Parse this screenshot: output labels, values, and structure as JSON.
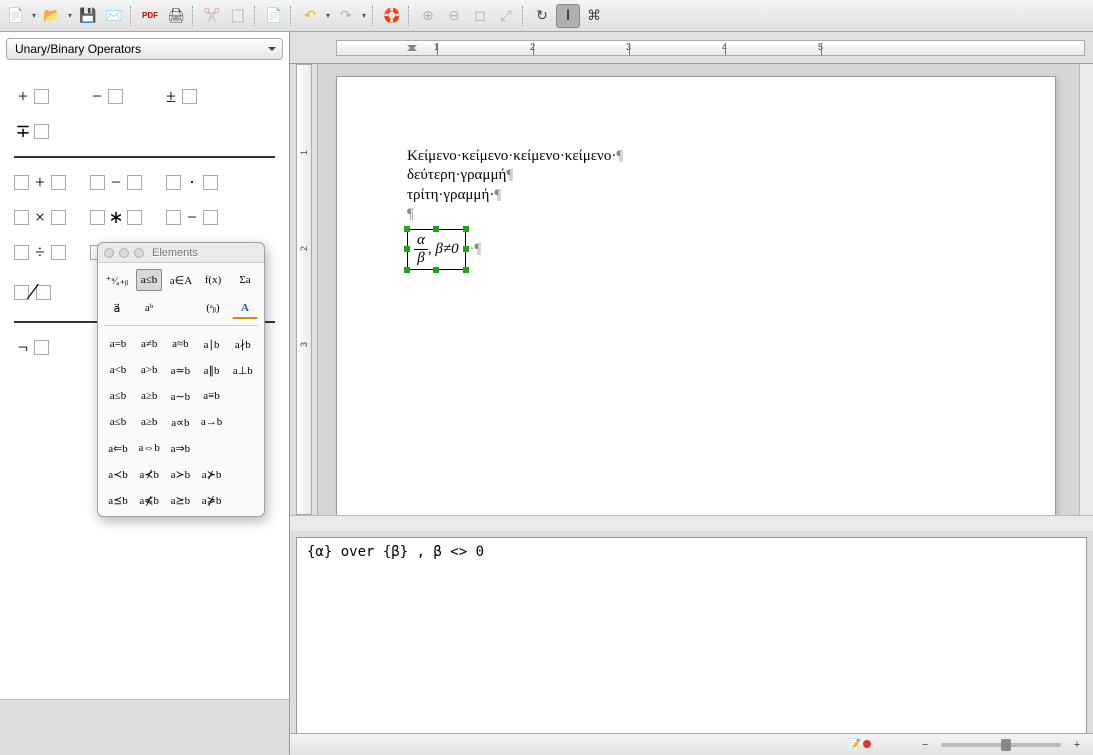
{
  "toolbar": {
    "items": [
      {
        "icon": "📄",
        "name": "new-doc",
        "interact": true,
        "dd": true
      },
      {
        "icon": "📂",
        "name": "open",
        "interact": true,
        "dd": true
      },
      {
        "icon": "💾",
        "name": "save",
        "interact": true
      },
      {
        "icon": "✉️",
        "name": "mail",
        "interact": true
      },
      {
        "sep": true
      },
      {
        "icon": "PDF",
        "name": "export-pdf",
        "interact": true,
        "small": true
      },
      {
        "icon": "🖨",
        "name": "print",
        "interact": true
      },
      {
        "sep": true
      },
      {
        "icon": "✂️",
        "name": "cut",
        "interact": false,
        "dim": true
      },
      {
        "icon": "📋",
        "name": "copy",
        "interact": false,
        "dim": true
      },
      {
        "sep": true
      },
      {
        "icon": "📄",
        "name": "paste",
        "interact": true
      },
      {
        "sep": true
      },
      {
        "icon": "↶",
        "name": "undo",
        "interact": true,
        "color": "#e6b800",
        "dd": true
      },
      {
        "icon": "↷",
        "name": "redo",
        "interact": false,
        "dim": true,
        "dd": true
      },
      {
        "sep": true
      },
      {
        "icon": "🛟",
        "name": "help",
        "interact": true
      },
      {
        "sep": true
      },
      {
        "icon": "⊕",
        "name": "zoom-in",
        "interact": false,
        "dim": true
      },
      {
        "icon": "⊖",
        "name": "zoom-out",
        "interact": false,
        "dim": true
      },
      {
        "icon": "◻",
        "name": "zoom-100",
        "interact": false,
        "dim": true
      },
      {
        "icon": "⤢",
        "name": "zoom-fit",
        "interact": false,
        "dim": true
      },
      {
        "sep": true
      },
      {
        "icon": "↻",
        "name": "refresh",
        "interact": true
      },
      {
        "icon": "𝐈",
        "name": "formula-cursor",
        "interact": true,
        "active": true
      },
      {
        "icon": "⌘",
        "name": "symbols",
        "interact": true
      }
    ]
  },
  "sidebar": {
    "combo": "Unary/Binary Operators",
    "group1": [
      {
        "lbl": "+",
        "name": "plus-sign"
      },
      {
        "lbl": "−",
        "name": "minus-sign"
      },
      {
        "lbl": "±",
        "name": "plus-minus"
      },
      {
        "lbl": "∓",
        "name": "minus-plus"
      }
    ],
    "group2": [
      {
        "lbl": "+",
        "name": "addition"
      },
      {
        "lbl": "−",
        "name": "subtraction"
      },
      {
        "lbl": "·",
        "name": "dot-product"
      },
      {
        "lbl": "×",
        "name": "multiplication"
      },
      {
        "lbl": "∗",
        "name": "asterisk"
      },
      {
        "lbl": "−",
        "name": "subtraction-alt"
      },
      {
        "lbl": "÷",
        "name": "division"
      },
      {
        "lbl": "÷",
        "name": "division-alt"
      },
      {
        "lbl": "−",
        "name": "minus-alt"
      },
      {
        "lbl": "/",
        "name": "fraction",
        "slash": true
      }
    ],
    "group3": [
      {
        "lbl": "¬",
        "name": "boolean-not"
      }
    ]
  },
  "elements_window": {
    "title": "Elements",
    "categories": [
      {
        "lbl": "⁺ᵃ⁄ₐ₊ᵦ",
        "name": "cat-unary"
      },
      {
        "lbl": "a≤b",
        "name": "cat-relations",
        "sel": true
      },
      {
        "lbl": "a∈A",
        "name": "cat-set"
      },
      {
        "lbl": "f(x)",
        "name": "cat-functions"
      },
      {
        "lbl": "Σa",
        "name": "cat-operators"
      },
      {
        "lbl": "a⃗",
        "name": "cat-attributes"
      },
      {
        "lbl": "aᵇ",
        "name": "cat-brackets"
      },
      {
        "lbl": "",
        "name": "cat-spacer",
        "empty": true
      },
      {
        "lbl": "(ᵃᵦ)",
        "name": "cat-formats"
      },
      {
        "lbl": "A͟",
        "name": "cat-others",
        "colorA": true
      }
    ],
    "relations": [
      "a=b",
      "a≠b",
      "a≈b",
      "a∣b",
      "a∤b",
      "a<b",
      "a>b",
      "a≃b",
      "a∥b",
      "a⊥b",
      "a≤b",
      "a≥b",
      "a∼b",
      "a≡b",
      "",
      "a≤b",
      "a≥b",
      "a∝b",
      "a→b",
      "",
      "a⇐b",
      "a⇔b",
      "a⇒b",
      "",
      "",
      "a≺b",
      "a⊀b",
      "a≻b",
      "a⊁b",
      "",
      "a⪯b",
      "a⋠b",
      "a⪰b",
      "a⋡b",
      ""
    ]
  },
  "ruler": {
    "labels": [
      "1",
      "2",
      "3",
      "4",
      "5"
    ]
  },
  "vruler_labels": [
    "1",
    "2",
    "3"
  ],
  "document": {
    "line1": "Κείμενο·κείμενο·κείμενο·κείμενο·",
    "line2": "δεύτερη·γραμμή",
    "line3": "τρίτη·γραμμή·",
    "formula": {
      "num": "α",
      "den": "β",
      "rest": ", β≠0"
    }
  },
  "editor": {
    "code": "{α} over {β} , β <> 0"
  },
  "statusbar": {
    "dot_title": "modified"
  }
}
